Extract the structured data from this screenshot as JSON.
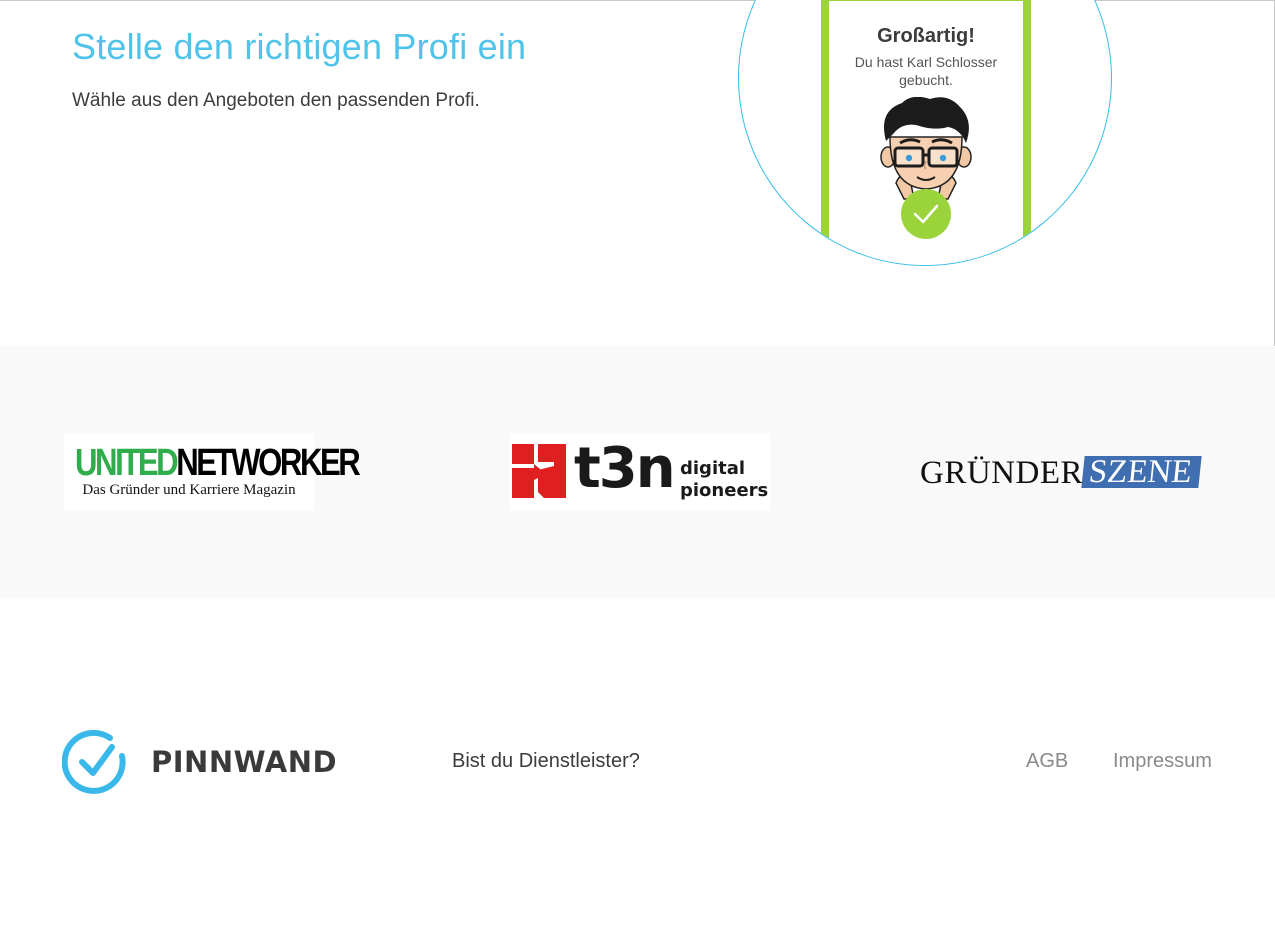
{
  "hero": {
    "title": "Stelle den richtigen Profi ein",
    "subtitle": "Wähle aus den Angeboten den passenden Profi."
  },
  "confirmation_card": {
    "title": "Großartig!",
    "text": "Du hast Karl Schlosser gebucht.",
    "accent_color": "#9ad43a",
    "circle_color": "#35bfe6"
  },
  "press_logos": {
    "united_networker": {
      "word_green": "UNITED",
      "word_black": "NETWORKER",
      "tagline": "Das Gründer und Karriere Magazin"
    },
    "t3n": {
      "word": "t3n",
      "line1": "digital",
      "line2": "pioneers",
      "icon_color": "#e02020"
    },
    "gruenderszene": {
      "part1": "GRÜNDER",
      "part2": "SZENE",
      "accent_color": "#3f6fb0"
    }
  },
  "footer": {
    "brand": "PINNWAND",
    "provider_link": "Bist du Dienstleister?",
    "agb_link": "AGB",
    "impressum_link": "Impressum"
  }
}
